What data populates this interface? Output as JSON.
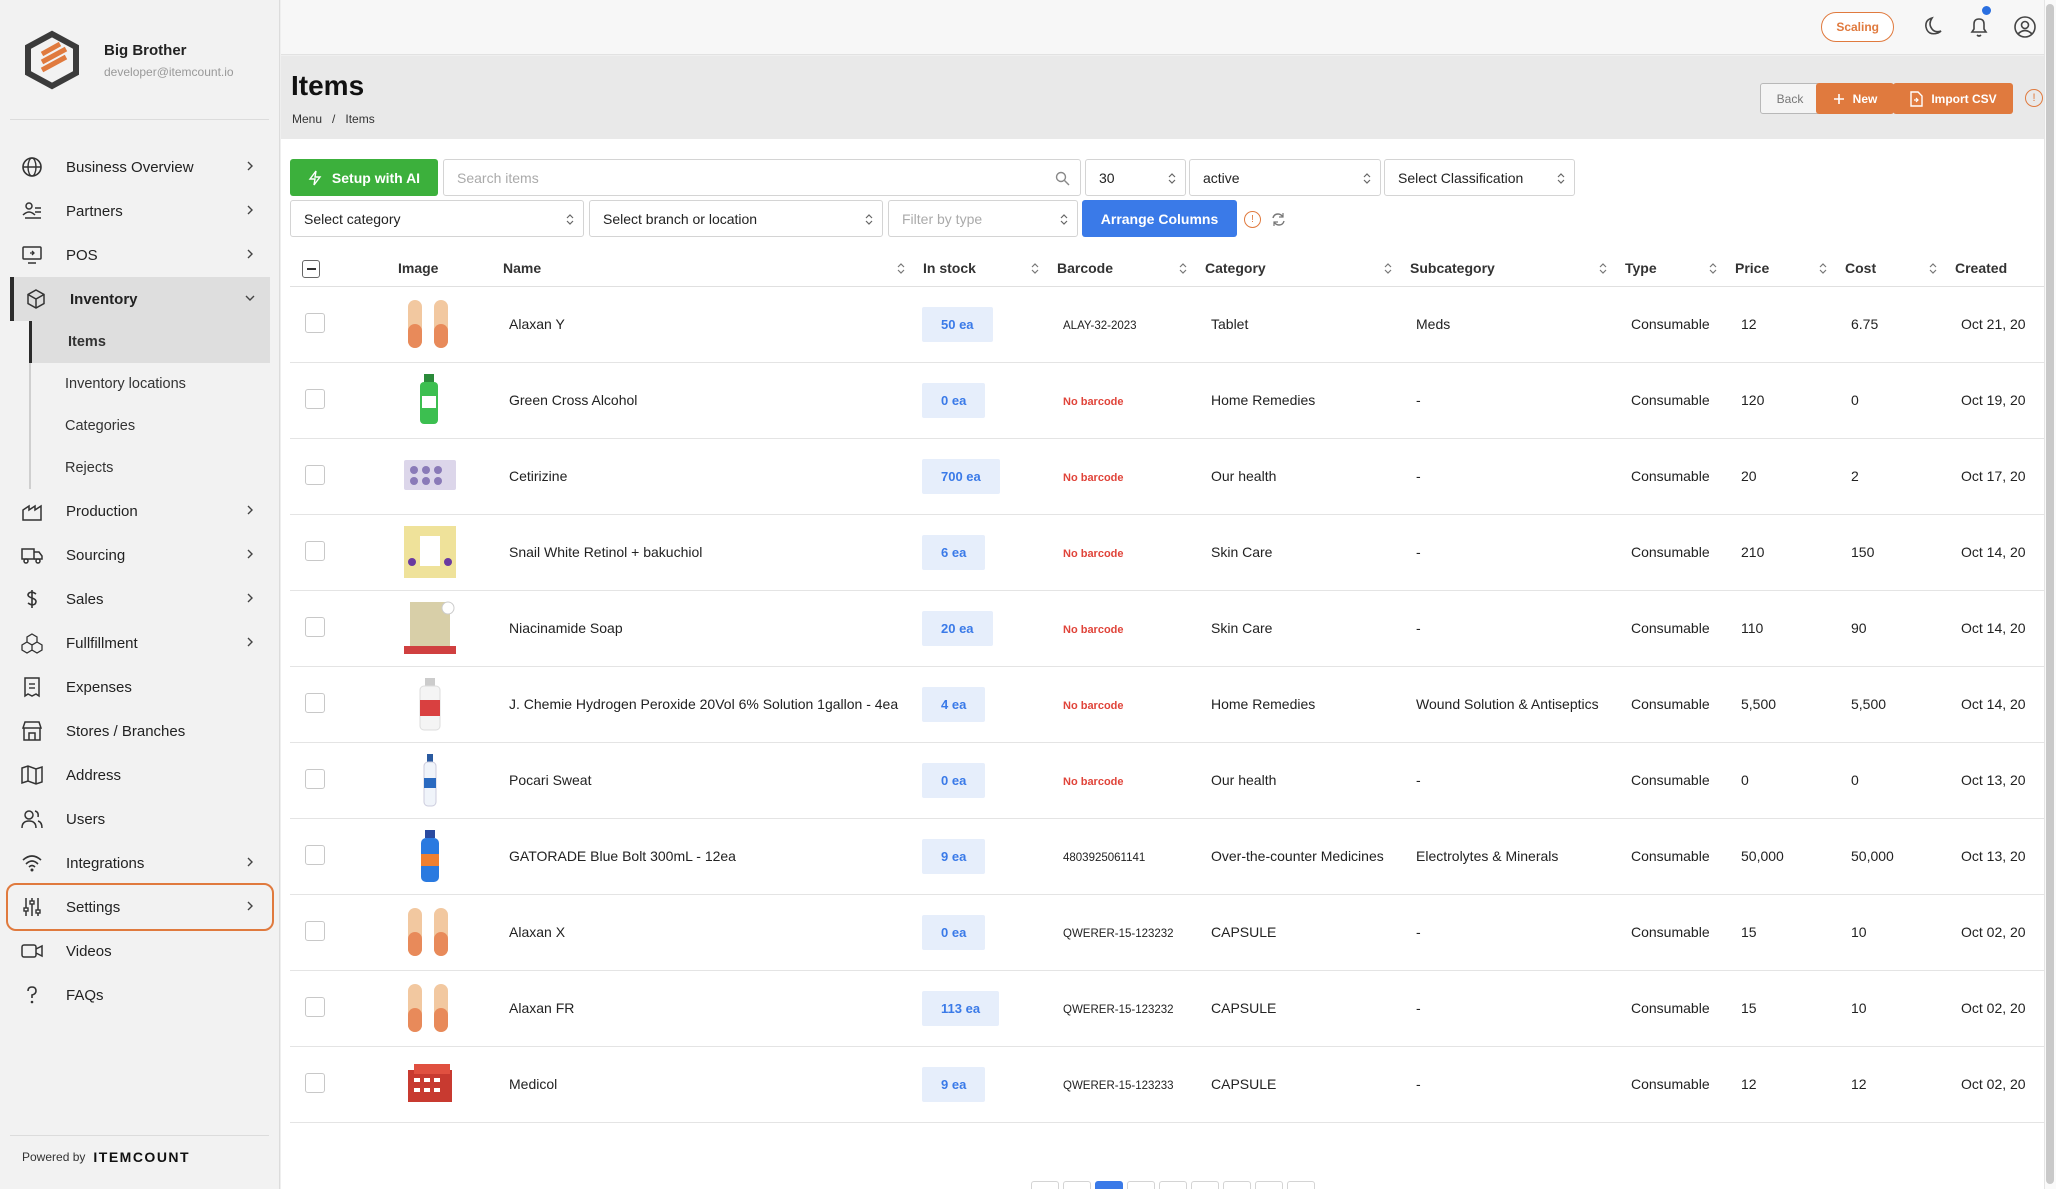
{
  "app": {
    "org_name": "Big Brother",
    "org_email": "developer@itemcount.io",
    "powered_by_label": "Powered by",
    "powered_by_brand": "ITEMCOUNT"
  },
  "sidebar": {
    "items": [
      {
        "label": "Business Overview",
        "icon": "globe-icon"
      },
      {
        "label": "Partners",
        "icon": "partners-icon"
      },
      {
        "label": "POS",
        "icon": "pos-icon"
      },
      {
        "label": "Inventory",
        "icon": "box-icon"
      },
      {
        "label": "Production",
        "icon": "factory-icon"
      },
      {
        "label": "Sourcing",
        "icon": "truck-icon"
      },
      {
        "label": "Sales",
        "icon": "dollar-icon"
      },
      {
        "label": "Fullfillment",
        "icon": "boxes-icon"
      },
      {
        "label": "Expenses",
        "icon": "receipt-icon"
      },
      {
        "label": "Stores / Branches",
        "icon": "store-icon"
      },
      {
        "label": "Address",
        "icon": "map-icon"
      },
      {
        "label": "Users",
        "icon": "users-icon"
      },
      {
        "label": "Integrations",
        "icon": "wifi-icon"
      },
      {
        "label": "Settings",
        "icon": "sliders-icon"
      },
      {
        "label": "Videos",
        "icon": "video-icon"
      },
      {
        "label": "FAQs",
        "icon": "question-icon"
      }
    ],
    "inventory_sub": [
      {
        "label": "Items"
      },
      {
        "label": "Inventory locations"
      },
      {
        "label": "Categories"
      },
      {
        "label": "Rejects"
      }
    ]
  },
  "topbar": {
    "scaling_label": "Scaling",
    "accent": "#e07a3e"
  },
  "header": {
    "title": "Items",
    "breadcrumb": [
      "Menu",
      "/",
      "Items"
    ],
    "back_label": "Back",
    "new_label": "New",
    "import_label": "Import CSV"
  },
  "filters": {
    "setup_ai_label": "Setup with AI",
    "search_placeholder": "Search items",
    "page_size": "30",
    "status": "active",
    "classification": "Select Classification",
    "category": "Select category",
    "branch": "Select branch or location",
    "type_placeholder": "Filter by type",
    "arrange_label": "Arrange Columns"
  },
  "table": {
    "columns": [
      "Image",
      "Name",
      "In stock",
      "Barcode",
      "Category",
      "Subcategory",
      "Type",
      "Price",
      "Cost",
      "Created"
    ],
    "rows": [
      {
        "name": "Alaxan Y",
        "stock": "50 ea",
        "barcode": "ALAY-32-2023",
        "has_barcode": true,
        "category": "Tablet",
        "subcategory": "Meds",
        "type": "Consumable",
        "price": "12",
        "cost": "6.75",
        "created": "Oct 21, 20",
        "thumb": "capsule"
      },
      {
        "name": "Green Cross Alcohol",
        "stock": "0 ea",
        "barcode": "No barcode",
        "has_barcode": false,
        "category": "Home Remedies",
        "subcategory": "-",
        "type": "Consumable",
        "price": "120",
        "cost": "0",
        "created": "Oct 19, 20",
        "thumb": "green-bottle"
      },
      {
        "name": "Cetirizine",
        "stock": "700 ea",
        "barcode": "No barcode",
        "has_barcode": false,
        "category": "Our health",
        "subcategory": "-",
        "type": "Consumable",
        "price": "20",
        "cost": "2",
        "created": "Oct 17, 20",
        "thumb": "blister"
      },
      {
        "name": "Snail White Retinol + bakuchiol",
        "stock": "6 ea",
        "barcode": "No barcode",
        "has_barcode": false,
        "category": "Skin Care",
        "subcategory": "-",
        "type": "Consumable",
        "price": "210",
        "cost": "150",
        "created": "Oct 14, 20",
        "thumb": "yellow-box"
      },
      {
        "name": "Niacinamide Soap",
        "stock": "20 ea",
        "barcode": "No barcode",
        "has_barcode": false,
        "category": "Skin Care",
        "subcategory": "-",
        "type": "Consumable",
        "price": "110",
        "cost": "90",
        "created": "Oct 14, 20",
        "thumb": "soap"
      },
      {
        "name": "J. Chemie Hydrogen Peroxide 20Vol 6% Solution 1gallon - 4ea",
        "stock": "4 ea",
        "barcode": "No barcode",
        "has_barcode": false,
        "category": "Home Remedies",
        "subcategory": "Wound Solution & Antiseptics",
        "type": "Consumable",
        "price": "5,500",
        "cost": "5,500",
        "created": "Oct 14, 20",
        "thumb": "red-bottle"
      },
      {
        "name": "Pocari Sweat",
        "stock": "0 ea",
        "barcode": "No barcode",
        "has_barcode": false,
        "category": "Our health",
        "subcategory": "-",
        "type": "Consumable",
        "price": "0",
        "cost": "0",
        "created": "Oct 13, 20",
        "thumb": "white-bottle"
      },
      {
        "name": "GATORADE Blue Bolt 300mL - 12ea",
        "stock": "9 ea",
        "barcode": "4803925061141",
        "has_barcode": true,
        "category": "Over-the-counter Medicines",
        "subcategory": "Electrolytes & Minerals",
        "type": "Consumable",
        "price": "50,000",
        "cost": "50,000",
        "created": "Oct 13, 20",
        "thumb": "blue-bottle"
      },
      {
        "name": "Alaxan X",
        "stock": "0 ea",
        "barcode": "QWERER-15-123232",
        "has_barcode": true,
        "category": "CAPSULE",
        "subcategory": "-",
        "type": "Consumable",
        "price": "15",
        "cost": "10",
        "created": "Oct 02, 20",
        "thumb": "capsule"
      },
      {
        "name": "Alaxan FR",
        "stock": "113 ea",
        "barcode": "QWERER-15-123232",
        "has_barcode": true,
        "category": "CAPSULE",
        "subcategory": "-",
        "type": "Consumable",
        "price": "15",
        "cost": "10",
        "created": "Oct 02, 20",
        "thumb": "capsule"
      },
      {
        "name": "Medicol",
        "stock": "9 ea",
        "barcode": "QWERER-15-123233",
        "has_barcode": true,
        "category": "CAPSULE",
        "subcategory": "-",
        "type": "Consumable",
        "price": "12",
        "cost": "12",
        "created": "Oct 02, 20",
        "thumb": "red-pack"
      }
    ]
  },
  "pagination": {
    "active_page_index": 2,
    "page_count_visible": 9
  },
  "colors": {
    "primary_blue": "#3a7ae8",
    "green": "#3cb03c",
    "orange": "#e07a3e",
    "danger": "#e0443a"
  }
}
